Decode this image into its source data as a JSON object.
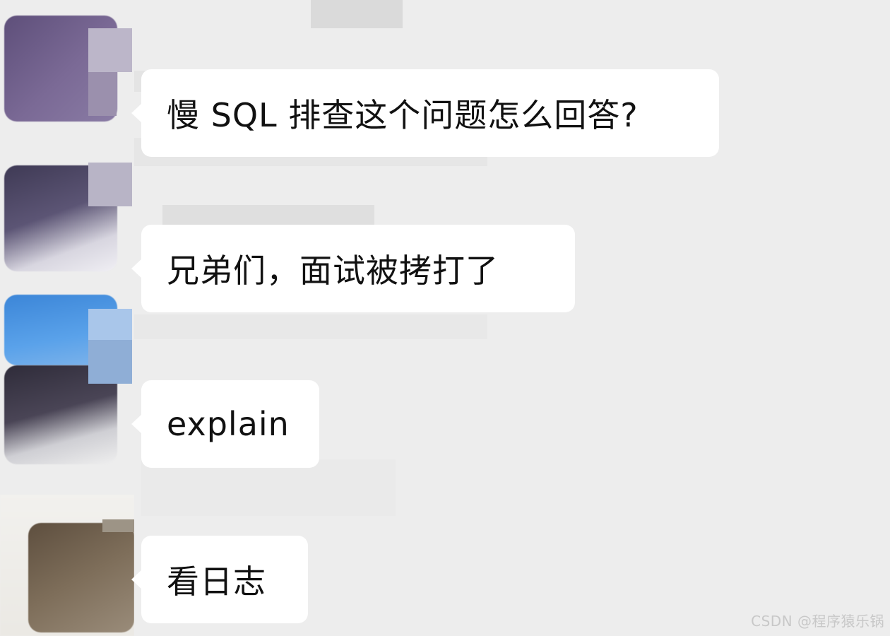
{
  "messages": [
    {
      "text": "慢 SQL 排查这个问题怎么回答?"
    },
    {
      "text": "兄弟们，面试被拷打了"
    },
    {
      "text": "explain"
    },
    {
      "text": "看日志"
    }
  ],
  "watermark": "CSDN @程序猿乐锅",
  "colors": {
    "background": "#ededed",
    "bubble": "#ffffff",
    "text": "#111111",
    "avatar_1": "#6f6289",
    "avatar_2": "#4f4b66",
    "avatar_3": "#4a8fdc",
    "avatar_4": "#7a6a58"
  }
}
